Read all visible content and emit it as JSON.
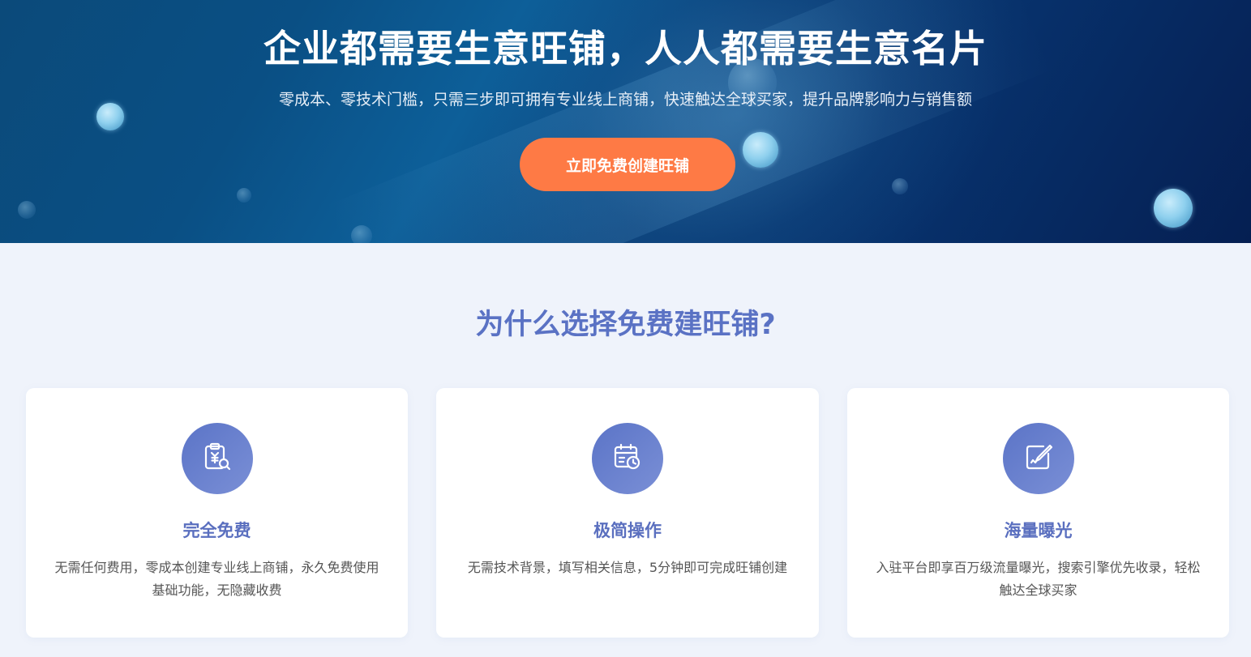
{
  "hero": {
    "title": "企业都需要生意旺铺，人人都需要生意名片",
    "subtitle": "零成本、零技术门槛，只需三步即可拥有专业线上商铺，快速触达全球买家，提升品牌影响力与销售额",
    "cta_label": "立即免费创建旺铺",
    "cta_color": "#fe7a45"
  },
  "features": {
    "title": "为什么选择免费建旺铺?",
    "title_color": "#5a72c4",
    "cards": [
      {
        "icon": "clipboard-yen-search-icon",
        "title": "完全免费",
        "desc": "无需任何费用，零成本创建专业线上商铺，永久免费使用基础功能，无隐藏收费"
      },
      {
        "icon": "calendar-clock-icon",
        "title": "极简操作",
        "desc": "无需技术背景，填写相关信息，5分钟即可完成旺铺创建"
      },
      {
        "icon": "edit-document-icon",
        "title": "海量曝光",
        "desc": "入驻平台即享百万级流量曝光，搜索引擎优先收录，轻松触达全球买家"
      }
    ]
  }
}
